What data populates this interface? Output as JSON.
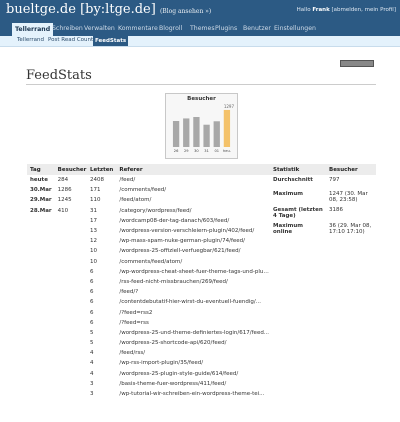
{
  "header": {
    "site_title": "bueltge.de [by:ltge.de]",
    "site_sub": "(Blog ansehen »)",
    "hello_prefix": "Hallo",
    "hello_user": "Frank",
    "hello_links": "[abmelden, mein Profil]"
  },
  "nav": {
    "items": [
      "Tellerrand",
      "Schreiben",
      "Verwalten",
      "Kommentare",
      "Blogroll",
      "Themes",
      "Plugins",
      "Benutzer",
      "Einstellungen"
    ]
  },
  "subnav": {
    "items": [
      "Tellerrand",
      "Post Read Counter",
      "FeedStats"
    ]
  },
  "page": {
    "title": "FeedStats"
  },
  "chart_data": {
    "type": "bar",
    "title": "Besucher",
    "total_label": "1297",
    "categories": [
      "26",
      "29",
      "30",
      "31",
      "01",
      "heu."
    ],
    "values": [
      910,
      1000,
      1050,
      780,
      900,
      1297
    ],
    "bar_colors": [
      "#a8a8a8",
      "#a8a8a8",
      "#a8a8a8",
      "#a8a8a8",
      "#a8a8a8",
      "#f4c26a"
    ],
    "ylim": [
      0,
      1400
    ]
  },
  "days_table": {
    "headers": [
      "Tag",
      "Besucher"
    ],
    "rows": [
      [
        "heute",
        "284"
      ],
      [
        "30.Mar",
        "1286"
      ],
      [
        "29.Mar",
        "1245"
      ],
      [
        "28.Mar",
        "410"
      ]
    ]
  },
  "ref_table": {
    "headers": [
      "Letzten",
      "Referer"
    ],
    "rows": [
      [
        "2408",
        "/feed/"
      ],
      [
        "171",
        "/comments/feed/"
      ],
      [
        "110",
        "/feed/atom/"
      ],
      [
        "31",
        "/category/wordpress/feed/"
      ],
      [
        "17",
        "/wordcamp08-der-tag-danach/603/feed/"
      ],
      [
        "13",
        "/wordpress-version-verschleiern-plugin/402/feed/"
      ],
      [
        "12",
        "/wp-mass-spam-nuke-german-plugin/74/feed/"
      ],
      [
        "10",
        "/wordpress-25-offiziell-verfuegbar/621/feed/"
      ],
      [
        "10",
        "/comments/feed/atom/"
      ],
      [
        "6",
        "/wp-wordpress-cheat-sheet-fuer-theme-tags-und-plug..."
      ],
      [
        "6",
        "/rss-feed-nicht-missbrauchen/269/feed/"
      ],
      [
        "6",
        "/feed/?"
      ],
      [
        "6",
        "/contentdebutatif-hier-wirst-du-eventuell-fuendig/..."
      ],
      [
        "6",
        "/?feed=rss2"
      ],
      [
        "6",
        "/?feed=rss"
      ],
      [
        "5",
        "/wordpress-25-und-theme-definiertes-login/617/feed..."
      ],
      [
        "5",
        "/wordpress-25-shortcode-api/620/feed/"
      ],
      [
        "4",
        "/feed/rss/"
      ],
      [
        "4",
        "/wp-rss-import-plugin/35/feed/"
      ],
      [
        "4",
        "/wordpress-25-plugin-style-guide/614/feed/"
      ],
      [
        "3",
        "/basis-theme-fuer-wordpress/411/feed/"
      ],
      [
        "3",
        "/wp-tutorial-wir-schreiben-ein-wordpress-theme-tei..."
      ]
    ]
  },
  "stats_table": {
    "headers": [
      "Statistik",
      "Besucher"
    ],
    "rows": [
      [
        "Durchschnitt",
        "797"
      ],
      [
        "Maximum",
        "1247 (30. Mar 08, 23:58)"
      ],
      [
        "Gesamt (letzten 4 Tage)",
        "3186"
      ],
      [
        "Maximum online",
        "36 (29. Mar 08, 17:10 17:10)"
      ]
    ]
  }
}
